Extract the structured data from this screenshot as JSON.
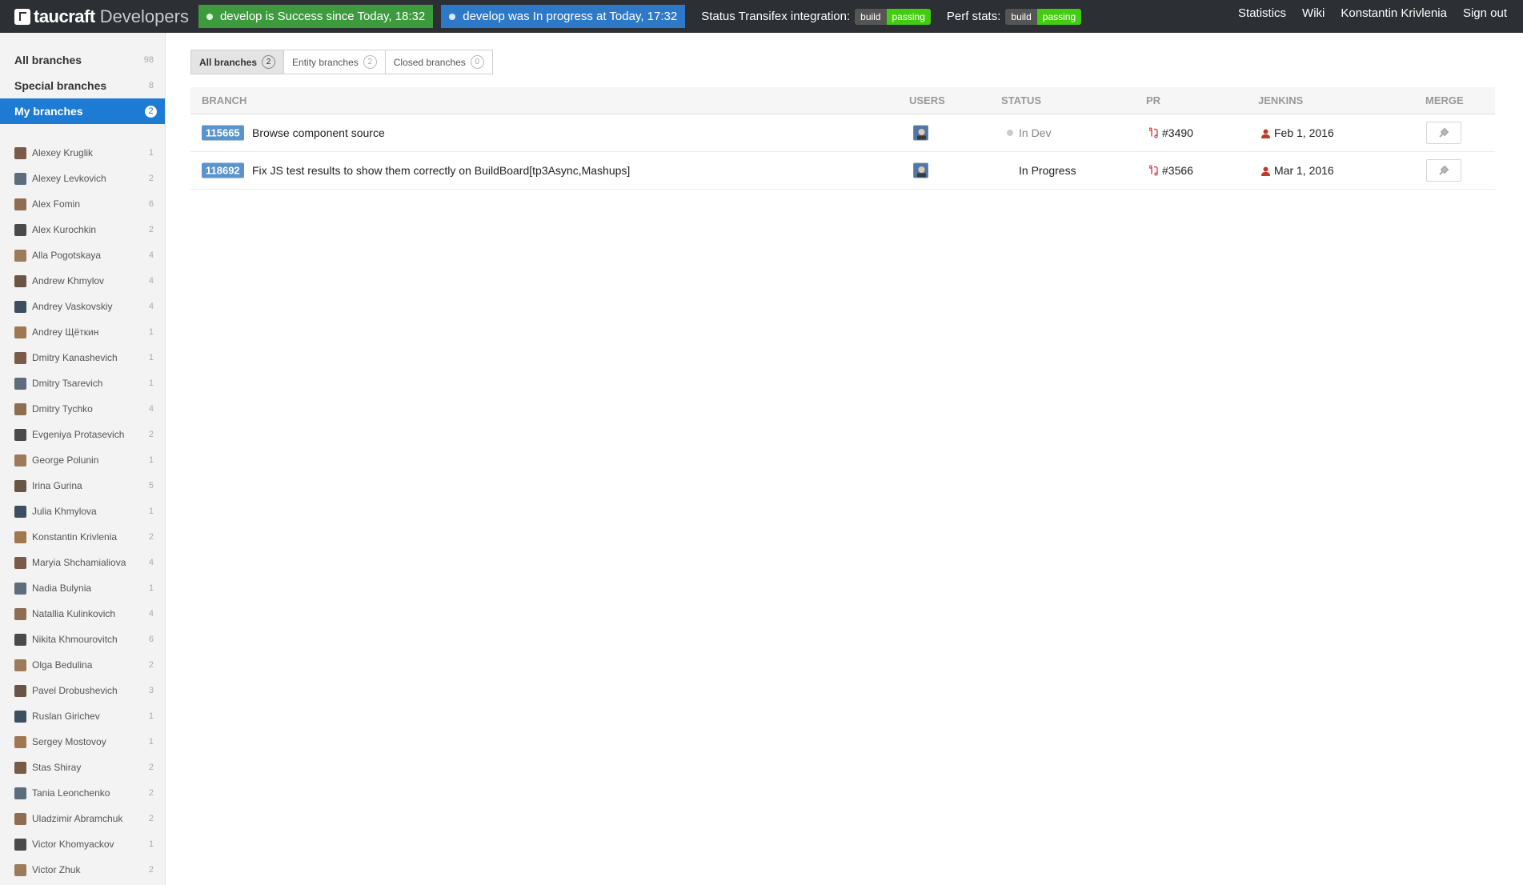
{
  "header": {
    "brand_name": "taucraft",
    "brand_sub": "Developers",
    "status_success": "develop is Success since Today, 18:32",
    "status_progress": "develop was In progress at Today, 17:32",
    "transifex_label": "Status Transifex integration:",
    "perf_label": "Perf stats:",
    "badge_left": "build",
    "badge_right": "passing",
    "links": [
      "Statistics",
      "Wiki",
      "Konstantin Krivlenia",
      "Sign out"
    ],
    "colors": {
      "bar": "#2c2f33",
      "success": "#3d9a3d",
      "progress": "#2d79c7",
      "passing": "#44cc11"
    }
  },
  "sidebar": {
    "nav": [
      {
        "label": "All branches",
        "count": "98"
      },
      {
        "label": "Special branches",
        "count": "8"
      },
      {
        "label": "My branches",
        "count": "2",
        "active": true
      }
    ],
    "users": [
      {
        "name": "Alexey Kruglik",
        "count": "1"
      },
      {
        "name": "Alexey Levkovich",
        "count": "2"
      },
      {
        "name": "Alex Fomin",
        "count": "6"
      },
      {
        "name": "Alex Kurochkin",
        "count": "2"
      },
      {
        "name": "Alla Pogotskaya",
        "count": "4"
      },
      {
        "name": "Andrew Khmylov",
        "count": "4"
      },
      {
        "name": "Andrey Vaskovskiy",
        "count": "4"
      },
      {
        "name": "Andrey Щёткин",
        "count": "1"
      },
      {
        "name": "Dmitry Kanashevich",
        "count": "1"
      },
      {
        "name": "Dmitry Tsarevich",
        "count": "1"
      },
      {
        "name": "Dmitry Tychko",
        "count": "4"
      },
      {
        "name": "Evgeniya Protasevich",
        "count": "2"
      },
      {
        "name": "George Polunin",
        "count": "1"
      },
      {
        "name": "Irina Gurina",
        "count": "5"
      },
      {
        "name": "Julia Khmylova",
        "count": "1"
      },
      {
        "name": "Konstantin Krivlenia",
        "count": "2"
      },
      {
        "name": "Maryia Shchamialiova",
        "count": "4"
      },
      {
        "name": "Nadia Bulynia",
        "count": "1"
      },
      {
        "name": "Natallia Kulinkovich",
        "count": "4"
      },
      {
        "name": "Nikita Khmourovitch",
        "count": "6"
      },
      {
        "name": "Olga Bedulina",
        "count": "2"
      },
      {
        "name": "Pavel Drobushevich",
        "count": "3"
      },
      {
        "name": "Ruslan Girichev",
        "count": "1"
      },
      {
        "name": "Sergey Mostovoy",
        "count": "1"
      },
      {
        "name": "Stas Shiray",
        "count": "2"
      },
      {
        "name": "Tania Leonchenko",
        "count": "2"
      },
      {
        "name": "Uladzimir Abramchuk",
        "count": "2"
      },
      {
        "name": "Victor Khomyackov",
        "count": "1"
      },
      {
        "name": "Victor Zhuk",
        "count": "2"
      }
    ]
  },
  "tabs": [
    {
      "label": "All branches",
      "count": "2",
      "active": true
    },
    {
      "label": "Entity branches",
      "count": "2"
    },
    {
      "label": "Closed branches",
      "count": "0"
    }
  ],
  "table": {
    "headers": [
      "BRANCH",
      "USERS",
      "STATUS",
      "PR",
      "JENKINS",
      "MERGE"
    ],
    "rows": [
      {
        "id": "115665",
        "title": "Browse component source",
        "status": "In Dev",
        "pr": "#3490",
        "jenkins": "Feb 1, 2016"
      },
      {
        "id": "118692",
        "title": "Fix JS test results to show them correctly on BuildBoard[tp3Async,Mashups]",
        "status": "In Progress",
        "pr": "#3566",
        "jenkins": "Mar 1, 2016"
      }
    ]
  }
}
